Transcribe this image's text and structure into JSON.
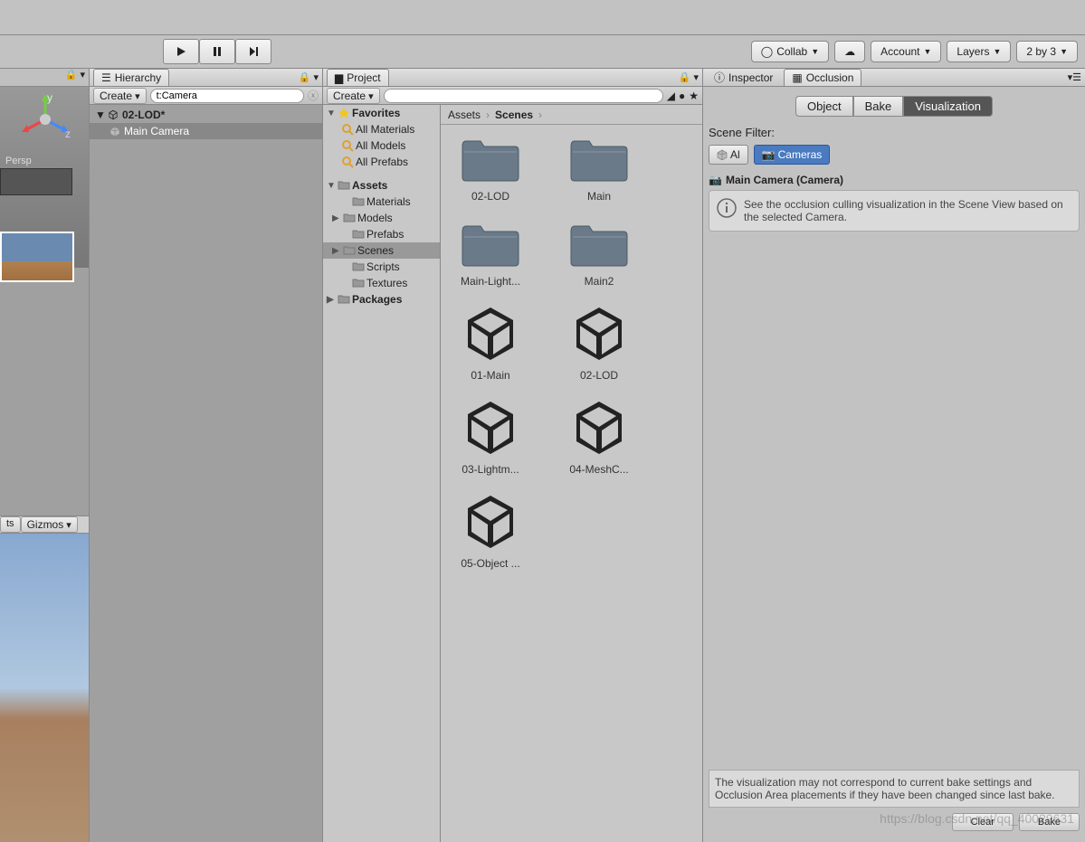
{
  "toolbar": {
    "collab": "Collab",
    "account": "Account",
    "layers": "Layers",
    "layout": "2 by 3"
  },
  "hierarchy": {
    "tab": "Hierarchy",
    "create": "Create",
    "search_value": "t:Camera",
    "scene_name": "02-LOD*",
    "items": [
      "Main Camera"
    ]
  },
  "project": {
    "tab": "Project",
    "create": "Create",
    "favorites": "Favorites",
    "fav_items": [
      "All Materials",
      "All Models",
      "All Prefabs"
    ],
    "assets": "Assets",
    "asset_folders": [
      "Materials",
      "Models",
      "Prefabs",
      "Scenes",
      "Scripts",
      "Textures"
    ],
    "packages": "Packages",
    "breadcrumb": [
      "Assets",
      "Scenes"
    ],
    "grid": [
      {
        "type": "folder",
        "label": "02-LOD"
      },
      {
        "type": "folder",
        "label": "Main"
      },
      {
        "type": "folder",
        "label": "Main-Light..."
      },
      {
        "type": "folder",
        "label": "Main2"
      },
      {
        "type": "scene",
        "label": "01-Main"
      },
      {
        "type": "scene",
        "label": "02-LOD"
      },
      {
        "type": "scene",
        "label": "03-Lightm..."
      },
      {
        "type": "scene",
        "label": "04-MeshC..."
      },
      {
        "type": "scene",
        "label": "05-Object ..."
      }
    ]
  },
  "inspector": {
    "tabs": [
      "Inspector",
      "Occlusion"
    ],
    "active_tab": 1,
    "segments": [
      "Object",
      "Bake",
      "Visualization"
    ],
    "active_segment": 2,
    "filter_label": "Scene Filter:",
    "filters": [
      "Al",
      "Cameras"
    ],
    "active_filter": 1,
    "camera_header": "Main Camera (Camera)",
    "info_text": "See the occlusion culling visualization in the Scene View based on the selected Camera.",
    "footer_text": "The visualization may not correspond to current bake settings and Occlusion Area placements if they have been changed since last bake.",
    "clear_btn": "Clear",
    "bake_btn": "Bake"
  },
  "scene": {
    "persp": "Persp",
    "gizmos": "Gizmos",
    "ts_btn": "ts"
  },
  "watermark": "https://blog.csdn.net/qq_40029631"
}
